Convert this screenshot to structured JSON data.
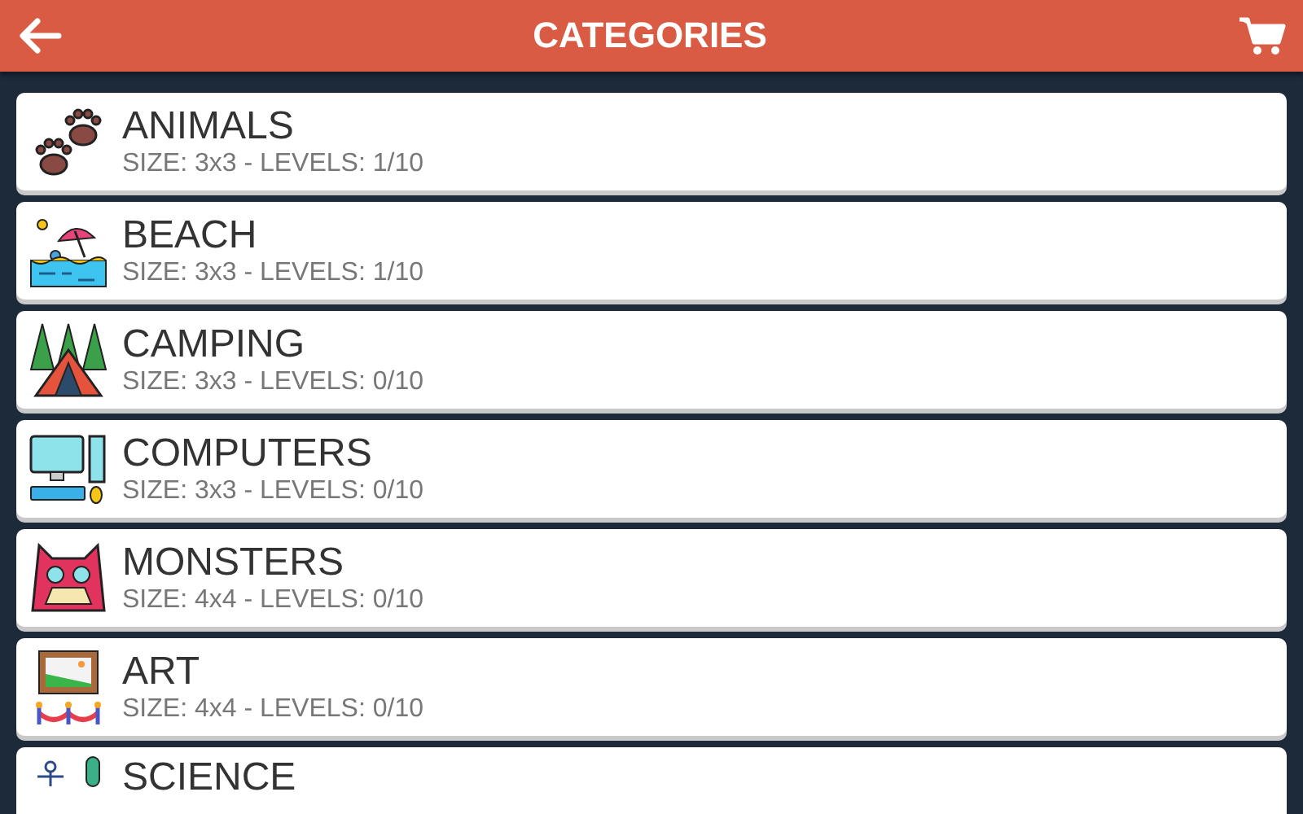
{
  "header": {
    "title": "CATEGORIES"
  },
  "categories": [
    {
      "name": "ANIMALS",
      "info": "SIZE: 3x3 - LEVELS: 1/10"
    },
    {
      "name": "BEACH",
      "info": "SIZE: 3x3 - LEVELS: 1/10"
    },
    {
      "name": "CAMPING",
      "info": "SIZE: 3x3 - LEVELS: 0/10"
    },
    {
      "name": "COMPUTERS",
      "info": "SIZE: 3x3 - LEVELS: 0/10"
    },
    {
      "name": "MONSTERS",
      "info": "SIZE: 4x4 - LEVELS: 0/10"
    },
    {
      "name": "ART",
      "info": "SIZE: 4x4 - LEVELS: 0/10"
    },
    {
      "name": "SCIENCE"
    }
  ]
}
